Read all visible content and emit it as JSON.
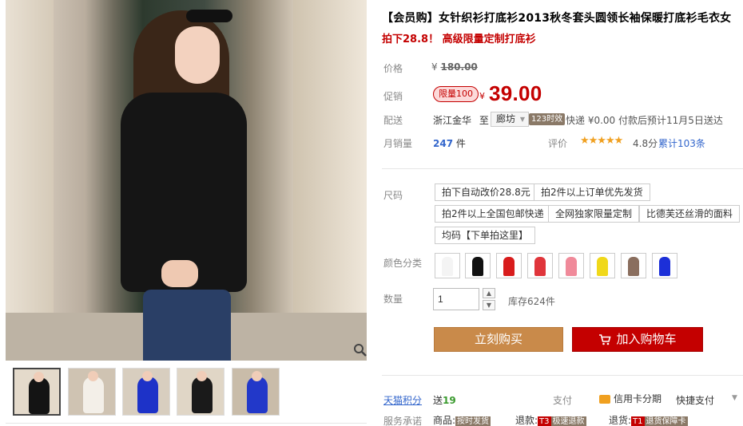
{
  "gallery": {
    "thumbnails": [
      {
        "name": "thumb-black-sweater",
        "figure_color": "#141414",
        "bg": "#e4dacb"
      },
      {
        "name": "thumb-white-sweater",
        "figure_color": "#f3efe8",
        "bg": "#cfc3b2"
      },
      {
        "name": "thumb-blue-sweater",
        "figure_color": "#1d32c8",
        "bg": "#d8cebf"
      },
      {
        "name": "thumb-black-sweater-2",
        "figure_color": "#1a1a1a",
        "bg": "#e0d6c6"
      },
      {
        "name": "thumb-blue-sweater-2",
        "figure_color": "#2238c9",
        "bg": "#c9bca9"
      }
    ]
  },
  "product": {
    "title": "【会员购】女针织衫打底衫2013秋冬套头圆领长袖保暖打底衫毛衣女",
    "subtitle": "拍下28.8！ 高级限量定制打底衫"
  },
  "price": {
    "label": "价格",
    "currency": "¥",
    "original": "180.00"
  },
  "promo": {
    "label": "促销",
    "badge": "限量100",
    "currency": "¥",
    "price": "39.00"
  },
  "shipping": {
    "label": "配送",
    "from": "浙江金华",
    "to_word": "至",
    "destination": "廊坊",
    "time_badge": "123时效",
    "info": "快递 ¥0.00 付款后预计11月5日送达"
  },
  "sales": {
    "label": "月销量",
    "count": "247",
    "unit": "件",
    "rating_label": "评价",
    "stars": "★★★★★",
    "score": "4.8分",
    "reviews": "累计103条"
  },
  "size": {
    "label": "尺码",
    "options": [
      "拍下自动改价28.8元",
      "拍2件以上订单优先发货",
      "拍2件以上全国包邮快递",
      "全网独家限量定制",
      "比德芙还丝滑的面料",
      "均码【下单拍这里】"
    ]
  },
  "color": {
    "label": "颜色分类",
    "swatches": [
      "#f4f4f4",
      "#111111",
      "#d81c1c",
      "#e0353b",
      "#f08a9a",
      "#f0d81a",
      "#8a6e5e",
      "#1c2fd8"
    ]
  },
  "quantity": {
    "label": "数量",
    "value": "1",
    "up": "▲",
    "down": "▼",
    "stock": "库存624件"
  },
  "actions": {
    "buy": "立刻购买",
    "cart": "加入购物车"
  },
  "points": {
    "label": "天猫积分",
    "value_prefix": "送",
    "value": "19"
  },
  "payment": {
    "label": "支付",
    "credit": "信用卡分期",
    "quickpay": "快捷支付",
    "dropdown_glyph": "▼"
  },
  "service": {
    "label": "服务承诺",
    "items": [
      {
        "prefix": "商品:",
        "tag": "",
        "text": "按时发货"
      },
      {
        "prefix": "退款:",
        "tag": "T3",
        "text": "极速退款"
      },
      {
        "prefix": "退货:",
        "tag": "T1",
        "text": "退货保障卡"
      }
    ]
  },
  "colors": {
    "accent_red": "#c40000",
    "buy_orange": "#c98a4a",
    "link_blue": "#3366cc",
    "star_orange": "#f0a020"
  }
}
